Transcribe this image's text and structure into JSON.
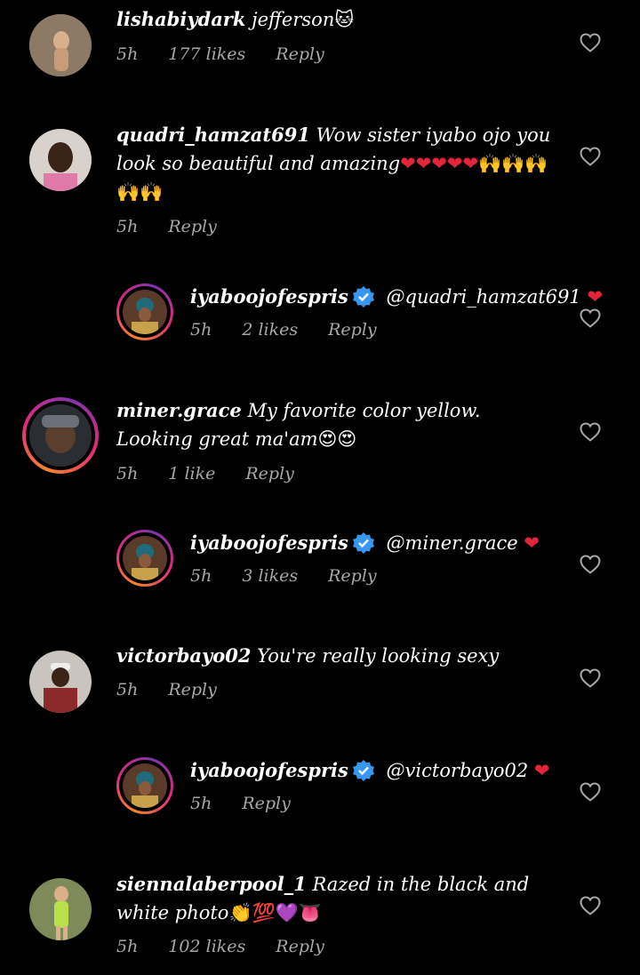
{
  "colors": {
    "background": "#000000",
    "text": "#ffffff",
    "meta": "#a8a8a8",
    "verified": "#3797f0",
    "heart_emoji": "#e3243b"
  },
  "comments": [
    {
      "username": "lishabiydark",
      "text": "jefferson",
      "emoji": "🐱",
      "time": "5h",
      "likes": "177 likes",
      "reply": "Reply"
    },
    {
      "username": "quadri_hamzat691",
      "text": "Wow sister iyabo ojo you look so beautiful and amazing",
      "emoji": "❤❤❤❤❤🙌🙌🙌🙌🙌",
      "time": "5h",
      "reply": "Reply"
    },
    {
      "username": "iyaboojofespris",
      "mention": "@quadri_hamzat691",
      "emoji": "❤",
      "time": "5h",
      "likes": "2 likes",
      "reply": "Reply"
    },
    {
      "username": "miner.grace",
      "text": "My favorite color yellow.  Looking great ma'am",
      "emoji": "😍😍",
      "time": "5h",
      "likes": "1 like",
      "reply": "Reply"
    },
    {
      "username": "iyaboojofespris",
      "mention": "@miner.grace",
      "emoji": "❤",
      "time": "5h",
      "likes": "3 likes",
      "reply": "Reply"
    },
    {
      "username": "victorbayo02",
      "text": "You're really looking sexy",
      "time": "5h",
      "reply": "Reply"
    },
    {
      "username": "iyaboojofespris",
      "mention": "@victorbayo02",
      "emoji": "❤",
      "time": "5h",
      "reply": "Reply"
    },
    {
      "username": "siennalaberpool_1",
      "text": "Razed in the black and white photo",
      "emoji": "👏💯💜👅",
      "time": "5h",
      "likes": "102 likes",
      "reply": "Reply"
    }
  ],
  "icons": {
    "like": "heart-outline-icon",
    "verified": "verified-badge-icon"
  }
}
